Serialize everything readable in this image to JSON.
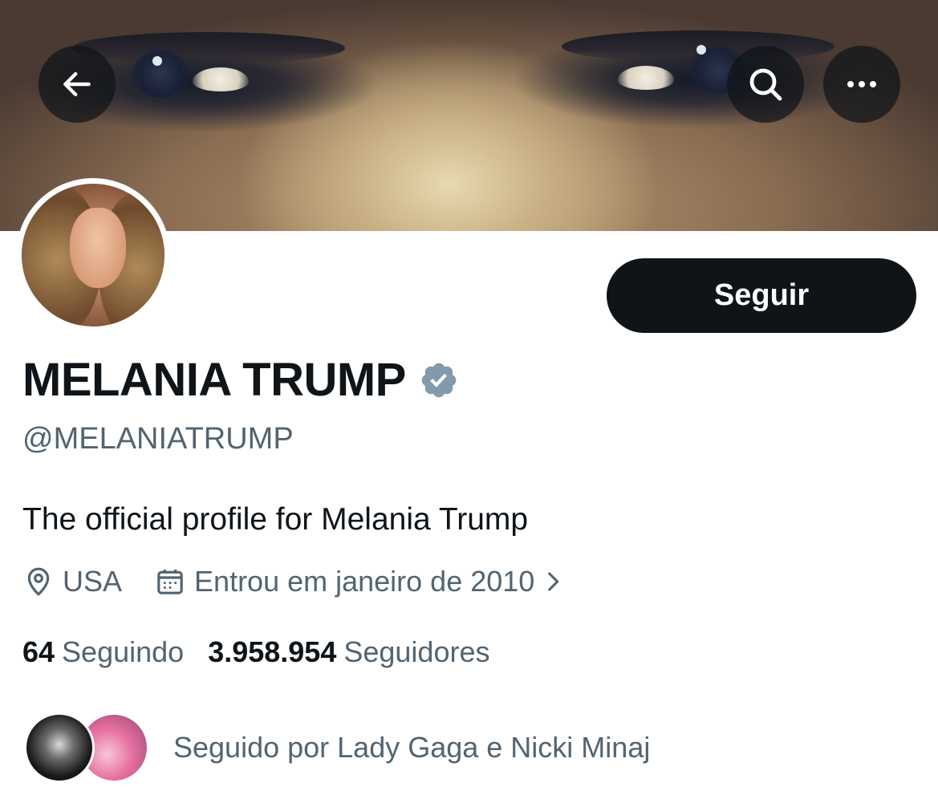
{
  "header": {
    "back_icon": "arrow-left-icon",
    "search_icon": "search-icon",
    "more_icon": "more-horizontal-icon"
  },
  "profile": {
    "name": "MELANIA TRUMP",
    "verified_icon": "verified-badge-icon",
    "verified_color": "#829aab",
    "handle": "@MELANIATRUMP",
    "bio": "The official profile for Melania Trump",
    "location": "USA",
    "location_icon": "map-pin-icon",
    "joined": "Entrou em janeiro de 2010",
    "joined_icon": "calendar-icon",
    "joined_chevron_icon": "chevron-right-icon"
  },
  "actions": {
    "follow_label": "Seguir"
  },
  "stats": {
    "following_count": "64",
    "following_label": "Seguindo",
    "followers_count": "3.958.954",
    "followers_label": "Seguidores"
  },
  "followed_by": {
    "text": "Seguido por Lady Gaga e Nicki Minaj"
  },
  "colors": {
    "primary_text": "#0f1419",
    "secondary_text": "#536471",
    "button_bg": "#0f1419",
    "button_text": "#ffffff"
  }
}
